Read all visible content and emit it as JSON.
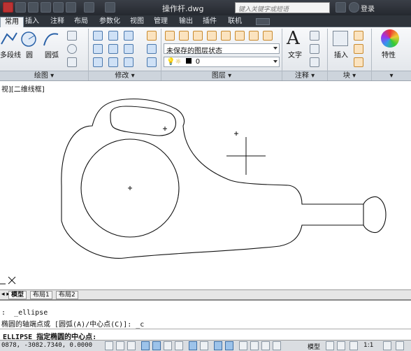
{
  "titlebar": {
    "document_title": "操作杆.dwg",
    "search_placeholder": "键入关键字或短语",
    "login_label": "登录"
  },
  "menu": {
    "tabs": [
      "常用",
      "插入",
      "注释",
      "布局",
      "参数化",
      "视图",
      "管理",
      "输出",
      "插件",
      "联机"
    ],
    "active": "常用"
  },
  "ribbon": {
    "draw": {
      "group_label": "绘图",
      "polyline_label": "多段线",
      "circle_label": "圆",
      "arc_label": "圆弧"
    },
    "modify": {
      "group_label": "修改"
    },
    "layers": {
      "group_label": "图层",
      "layer_state": "未保存的图层状态",
      "current_layer": "0"
    },
    "annotation": {
      "group_label": "注释",
      "text_label": "文字"
    },
    "block": {
      "group_label": "块",
      "insert_label": "插入"
    },
    "properties": {
      "label": "特性"
    }
  },
  "viewport": {
    "view_label": "视][二维线框]"
  },
  "layout_tabs": [
    "模型",
    "布局1",
    "布局2"
  ],
  "command": {
    "history": [
      ":  _ellipse",
      "椭圆的轴端点或 [圆弧(A)/中心点(C)]: _c"
    ],
    "prompt": "ELLIPSE 指定椭圆的中心点:"
  },
  "status": {
    "coordinates": "0878, -3082.7340, 0.0000",
    "model_label": "模型",
    "scale_label": "1:1"
  },
  "colors": {
    "title_bg": "#2f343b",
    "ribbon_bg": "#e9ecf0",
    "canvas_bg": "#ffffff",
    "status_on": "#9dc3ea"
  }
}
